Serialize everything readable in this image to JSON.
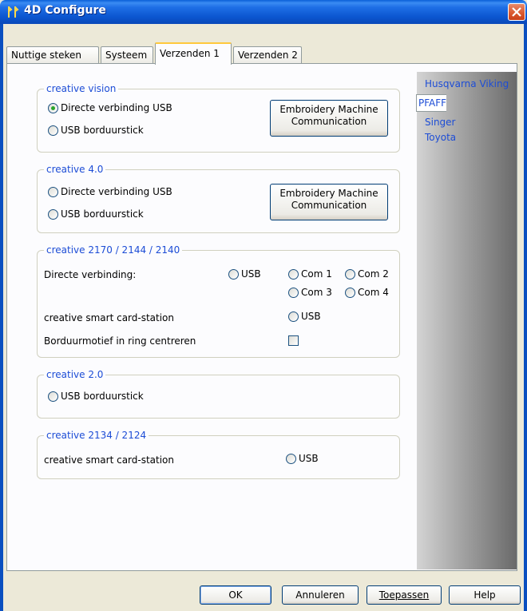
{
  "window": {
    "title": "4D Configure"
  },
  "tabs": [
    "Nuttige steken",
    "Systeem",
    "Verzenden 1",
    "Verzenden 2"
  ],
  "groups": {
    "vision": {
      "label": "creative vision",
      "radio_direct": "Directe verbinding USB",
      "radio_stick": "USB borduurstick",
      "button_line1": "Embroidery Machine",
      "button_line2": "Communication"
    },
    "c40": {
      "label": "creative 4.0",
      "radio_direct": "Directe verbinding USB",
      "radio_stick": "USB borduurstick",
      "button_line1": "Embroidery Machine",
      "button_line2": "Communication"
    },
    "c2170": {
      "label": "creative 2170 / 2144 / 2140",
      "direct_label": "Directe verbinding:",
      "usb": "USB",
      "com1": "Com 1",
      "com2": "Com 2",
      "com3": "Com 3",
      "com4": "Com 4",
      "smartcard_label": "creative smart card-station",
      "smartcard_usb": "USB",
      "center_label": "Borduurmotief in ring centreren"
    },
    "c20": {
      "label": "creative 2.0",
      "radio_stick": "USB borduurstick"
    },
    "c2134": {
      "label": "creative 2134 / 2124",
      "smartcard_label": "creative smart card-station",
      "smartcard_usb": "USB"
    }
  },
  "brands": [
    "Husqvarna Viking",
    "PFAFF",
    "Singer",
    "Toyota"
  ],
  "buttons": {
    "ok": "OK",
    "cancel": "Annuleren",
    "apply": "Toepassen",
    "help": "Help"
  },
  "colors": {
    "accent_blue": "#1d4dd6",
    "titlebar": "#0b56d0",
    "tab_highlight": "#ffc83c"
  }
}
